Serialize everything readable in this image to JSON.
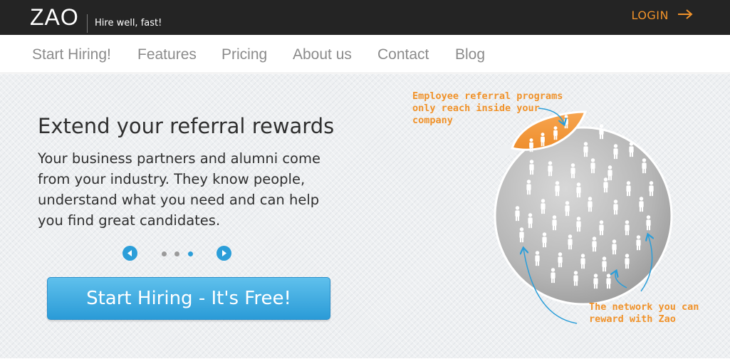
{
  "header": {
    "logo": "ZAO",
    "tagline": "Hire well, fast!",
    "login_label": "LOGIN",
    "login_icon": "arrow-right-icon",
    "accent_color": "#f0922a"
  },
  "nav": {
    "items": [
      {
        "label": "Start Hiring!"
      },
      {
        "label": "Features"
      },
      {
        "label": "Pricing"
      },
      {
        "label": "About us"
      },
      {
        "label": "Contact"
      },
      {
        "label": "Blog"
      }
    ]
  },
  "hero": {
    "title": "Extend your referral rewards",
    "text": "Your business partners and alumni come from your industry. They know people, understand what you need and can help you find great candidates.",
    "carousel": {
      "prev_icon": "chevron-left-icon",
      "next_icon": "chevron-right-icon",
      "slides": 3,
      "active_slide": 3
    },
    "cta_label": "Start Hiring - It's Free!",
    "cta_color": "#2a9bd7"
  },
  "illustration": {
    "annotation_top": "Employee referral programs\nonly reach inside your\ncompany",
    "annotation_bottom": "The network you can\nreward with Zao"
  }
}
